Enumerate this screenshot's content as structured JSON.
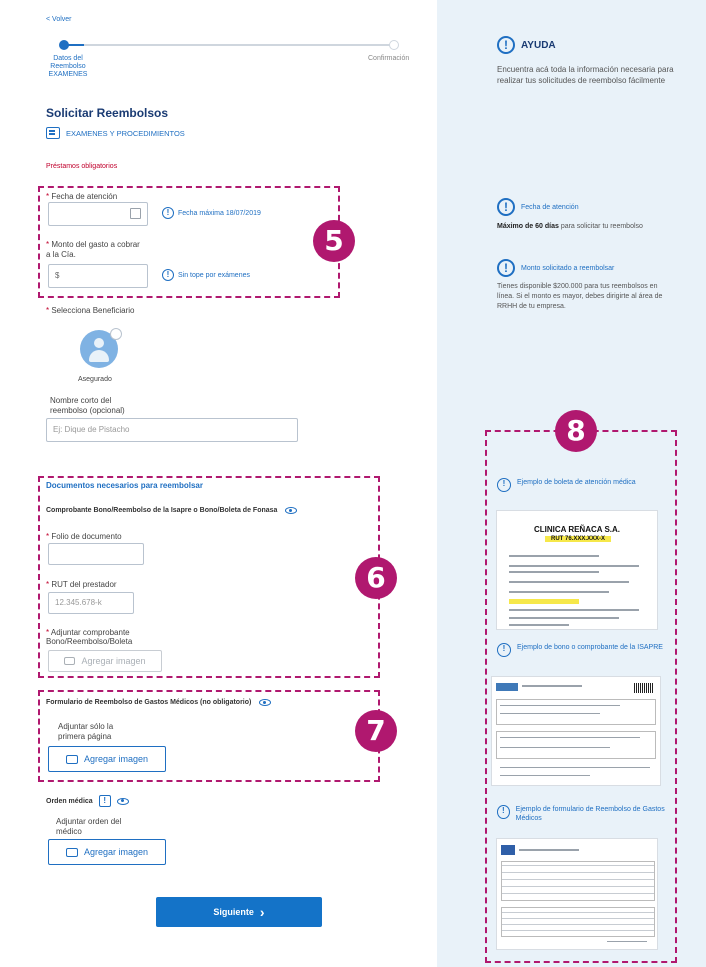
{
  "nav": {
    "back_label": "< Volver"
  },
  "stepper": {
    "step1_label": "Datos del Reembolso EXAMENES",
    "step2_label": "Confirmación"
  },
  "page": {
    "title": "Solicitar Reembolsos",
    "category": "EXAMENES Y PROCEDIMIENTOS",
    "required_note": "Préstamos obligatorios"
  },
  "form": {
    "fecha_label": "Fecha de atención",
    "fecha_help": "Fecha máxima 18/07/2019",
    "monto_label": "Monto del gasto a cobrar a la Cía.",
    "monto_value": "$",
    "monto_help": "Sin tope por exámenes",
    "beneficiario_label": "Selecciona Beneficiario",
    "beneficiario_name": "Asegurado",
    "nombre_corto_label": "Nombre corto del reembolso (opcional)",
    "nombre_corto_placeholder": "Ej: Dique de Pistacho"
  },
  "documents": {
    "section_title": "Documentos necesarios para reembolsar",
    "comprobante_title": "Comprobante Bono/Reembolso de la Isapre o Bono/Boleta de Fonasa",
    "folio_label": "Folio de documento",
    "rut_label": "RUT del prestador",
    "rut_placeholder": "12.345.678-k",
    "adjuntar_label": "Adjuntar comprobante Bono/Reembolso/Boleta",
    "add_image_disabled": "Agregar imagen",
    "formulario_title": "Formulario de Reembolso de Gastos Médicos (no obligatorio)",
    "formulario_attach_label": "Adjuntar sólo la primera página",
    "formulario_add_image": "Agregar imagen",
    "orden_title": "Orden médica",
    "orden_attach_label": "Adjuntar orden del médico",
    "orden_add_image": "Agregar imagen"
  },
  "submit": {
    "label": "Siguiente"
  },
  "help_panel": {
    "title": "AYUDA",
    "intro": "Encuentra acá toda la información necesaria para realizar tus solicitudes de reembolso fácilmente",
    "fecha_title": "Fecha de atención",
    "fecha_bold": "Máximo de 60 días",
    "fecha_text": "para solicitar tu reembolso",
    "monto_title": "Monto solicitado a reembolsar",
    "monto_text": "Tienes disponible $200.000 para tus reembolsos en línea. Si el monto es mayor, debes dirigirte al área de RRHH de tu empresa.",
    "example1_title": "Ejemplo de boleta de atención médica",
    "clinic_name": "CLINICA REÑACA S.A.",
    "clinic_rut": "RUT 76.XXX.XXX-X",
    "example2_title": "Ejemplo de bono o comprobante de la ISAPRE",
    "example3_title": "Ejemplo de formulario de Reembolso de Gastos Médicos"
  },
  "annotations": {
    "b5": "5",
    "b6": "6",
    "b7": "7",
    "b8": "8"
  },
  "colors": {
    "accent": "#1f6fc2",
    "annotation": "#b0186f",
    "panel_bg": "#e9f2f9",
    "button": "#1473c8"
  }
}
